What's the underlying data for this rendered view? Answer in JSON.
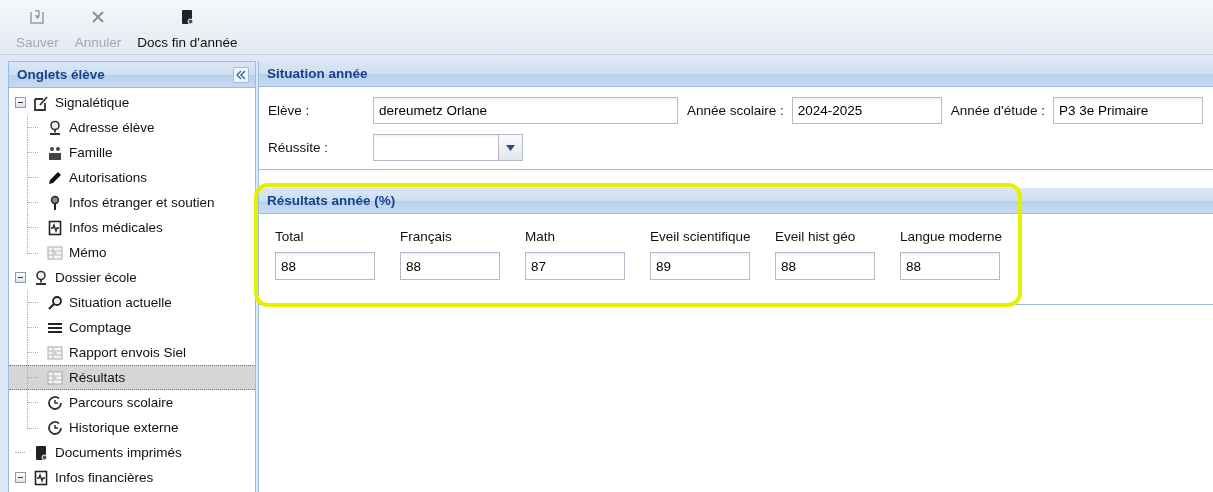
{
  "toolbar": [
    {
      "label": "Sauver",
      "disabled": true
    },
    {
      "label": "Annuler",
      "disabled": true
    },
    {
      "label": "Docs fin d'année",
      "disabled": false
    }
  ],
  "sidebar": {
    "title": "Onglets élève",
    "items": [
      {
        "label": "Signalétique",
        "expanded": true,
        "selected": false,
        "children": [
          {
            "label": "Adresse élève",
            "selected": false
          },
          {
            "label": "Famille",
            "selected": false
          },
          {
            "label": "Autorisations",
            "selected": false
          },
          {
            "label": "Infos étranger et soutien",
            "selected": false
          },
          {
            "label": "Infos médicales",
            "selected": false
          },
          {
            "label": "Mémo",
            "selected": false
          }
        ]
      },
      {
        "label": "Dossier école",
        "expanded": true,
        "selected": false,
        "children": [
          {
            "label": "Situation actuelle",
            "selected": false
          },
          {
            "label": "Comptage",
            "selected": false
          },
          {
            "label": "Rapport envois Siel",
            "selected": false
          },
          {
            "label": "Résultats",
            "selected": true
          },
          {
            "label": "Parcours scolaire",
            "selected": false
          },
          {
            "label": "Historique externe",
            "selected": false
          }
        ]
      },
      {
        "label": "Documents imprimés",
        "selected": false
      },
      {
        "label": "Infos financières",
        "expanded": true,
        "selected": false
      }
    ]
  },
  "situation": {
    "title": "Situation année",
    "fields": [
      {
        "label": "Elève :",
        "value": "dereumetz Orlane"
      },
      {
        "label": "Année scolaire :",
        "value": "2024-2025"
      },
      {
        "label": "Année d'étude :",
        "value": "P3 3e Primaire"
      }
    ],
    "reussite": {
      "label": "Réussite :"
    }
  },
  "results": {
    "title": "Résultats année (%)",
    "highlighted": true,
    "fields": [
      {
        "label": "Total",
        "value": "88"
      },
      {
        "label": "Français",
        "value": "88"
      },
      {
        "label": "Math",
        "value": "87"
      },
      {
        "label": "Eveil scientifique",
        "value": "89"
      },
      {
        "label": "Eveil hist géo",
        "value": "88"
      },
      {
        "label": "Langue moderne",
        "value": "88"
      }
    ]
  }
}
